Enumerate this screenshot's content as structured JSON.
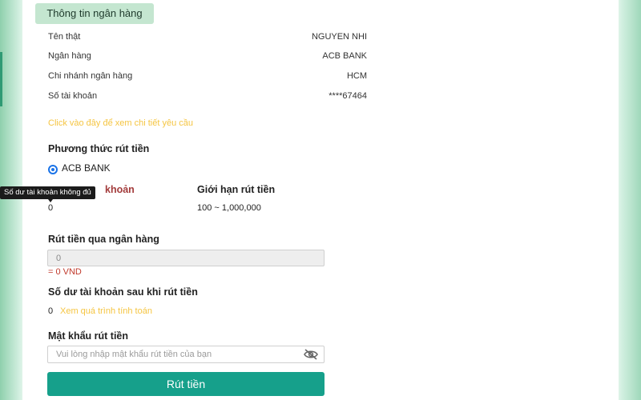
{
  "section": {
    "title": "Thông tin ngân hàng"
  },
  "bank_info": [
    {
      "label": "Tên thật",
      "value": "NGUYEN NHI"
    },
    {
      "label": "Ngân hàng",
      "value": "ACB BANK"
    },
    {
      "label": "Chi nhánh ngân hàng",
      "value": "HCM"
    },
    {
      "label": "Số tài khoản",
      "value": "****67464"
    }
  ],
  "detail_link": "Click vào đây để xem chi tiết yêu cầu",
  "withdraw_method": {
    "heading": "Phương thức rút tiền",
    "option_label": "ACB BANK",
    "selected": true
  },
  "balance_col": {
    "title_visible": "khoản",
    "value": "0"
  },
  "limit_col": {
    "title": "Giới hạn rút tiền",
    "value": "100 ~ 1,000,000"
  },
  "tooltip": "Số dư tài khoản không đủ",
  "bank_withdraw": {
    "heading": "Rút tiền qua ngân hàng",
    "input_value": "0",
    "converted": "= 0 VND"
  },
  "balance_after": {
    "heading": "Số dư tài khoản sau khi rút tiền",
    "value": "0",
    "link": "Xem quá trình tính toán"
  },
  "password": {
    "heading": "Mật khẩu rút tiền",
    "placeholder": "Vui lòng nhập mật khẩu rút tiền của bạn",
    "icon": "eye-off-icon"
  },
  "submit_label": "Rút tiền",
  "colors": {
    "accent": "#16a08b",
    "tag_bg": "#c4e6d0",
    "link": "#f5c542",
    "error": "#c0392b"
  }
}
